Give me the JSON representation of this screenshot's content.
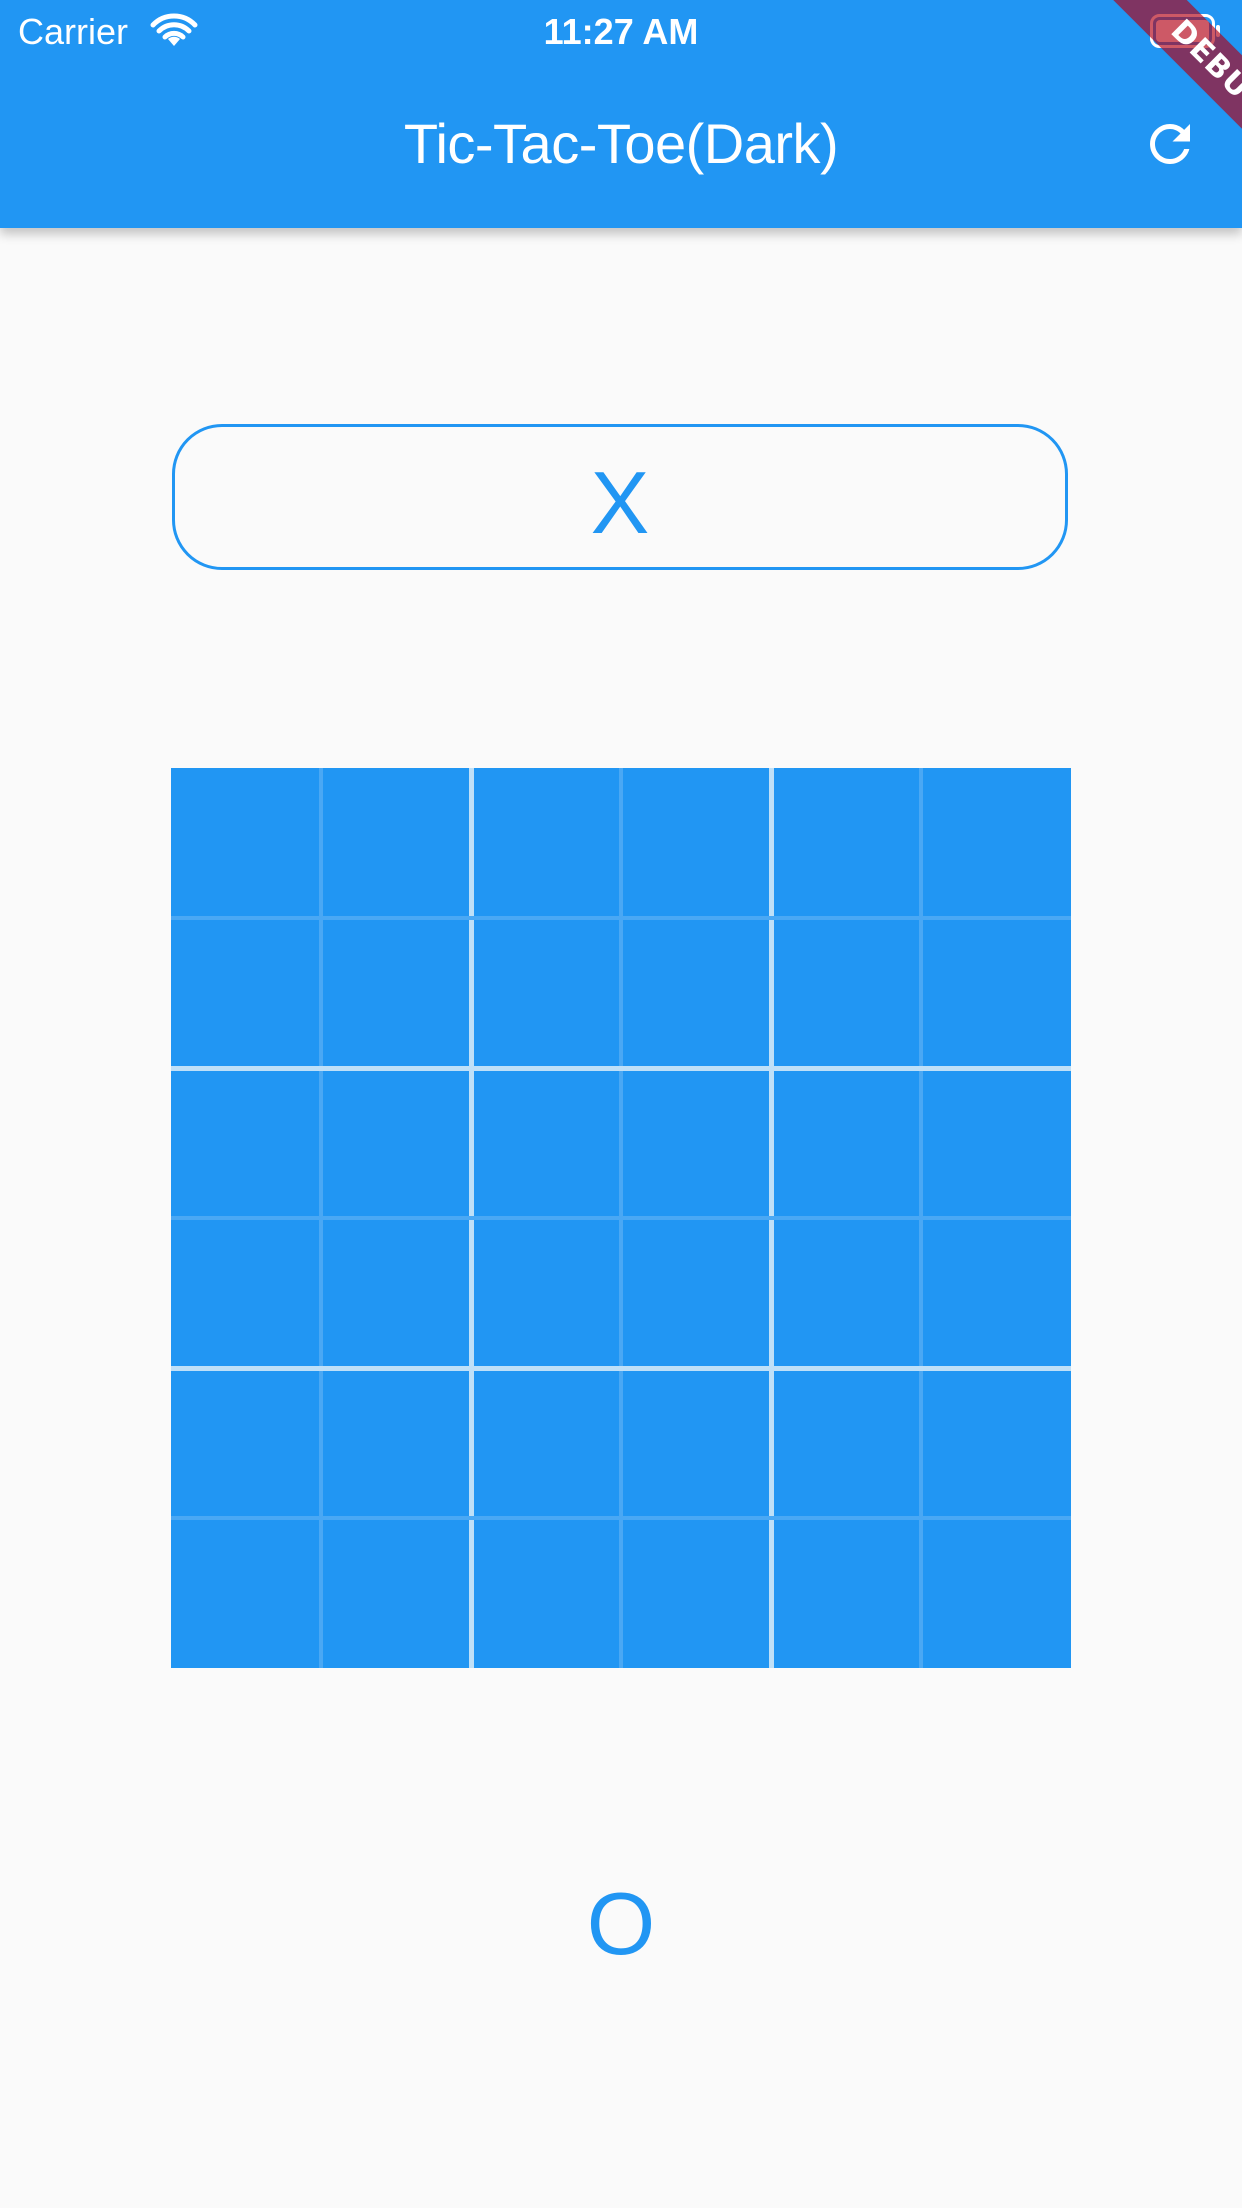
{
  "status_bar": {
    "carrier": "Carrier",
    "time": "11:27 AM",
    "wifi_icon": "wifi-icon",
    "battery_icon": "battery-icon"
  },
  "app_bar": {
    "title": "Tic-Tac-Toe(Dark)",
    "refresh_icon": "refresh-icon",
    "background_color": "#2196f3"
  },
  "debug_banner": {
    "label": "DEBUG",
    "color": "#b20014"
  },
  "turn_indicator": {
    "symbol": "X"
  },
  "board": {
    "rows": 6,
    "cols": 6,
    "cells": [
      [
        "",
        "",
        "",
        "",
        "",
        ""
      ],
      [
        "",
        "",
        "",
        "",
        "",
        ""
      ],
      [
        "",
        "",
        "",
        "",
        "",
        ""
      ],
      [
        "",
        "",
        "",
        "",
        "",
        ""
      ],
      [
        "",
        "",
        "",
        "",
        "",
        ""
      ],
      [
        "",
        "",
        "",
        "",
        "",
        ""
      ]
    ],
    "cell_color": "#2196f3",
    "thin_line_color": "#4aa8f4",
    "thick_line_color": "#bfe0f8"
  },
  "next_player": {
    "symbol": "O"
  },
  "theme": {
    "accent": "#2196f3",
    "background": "#fafafa"
  }
}
